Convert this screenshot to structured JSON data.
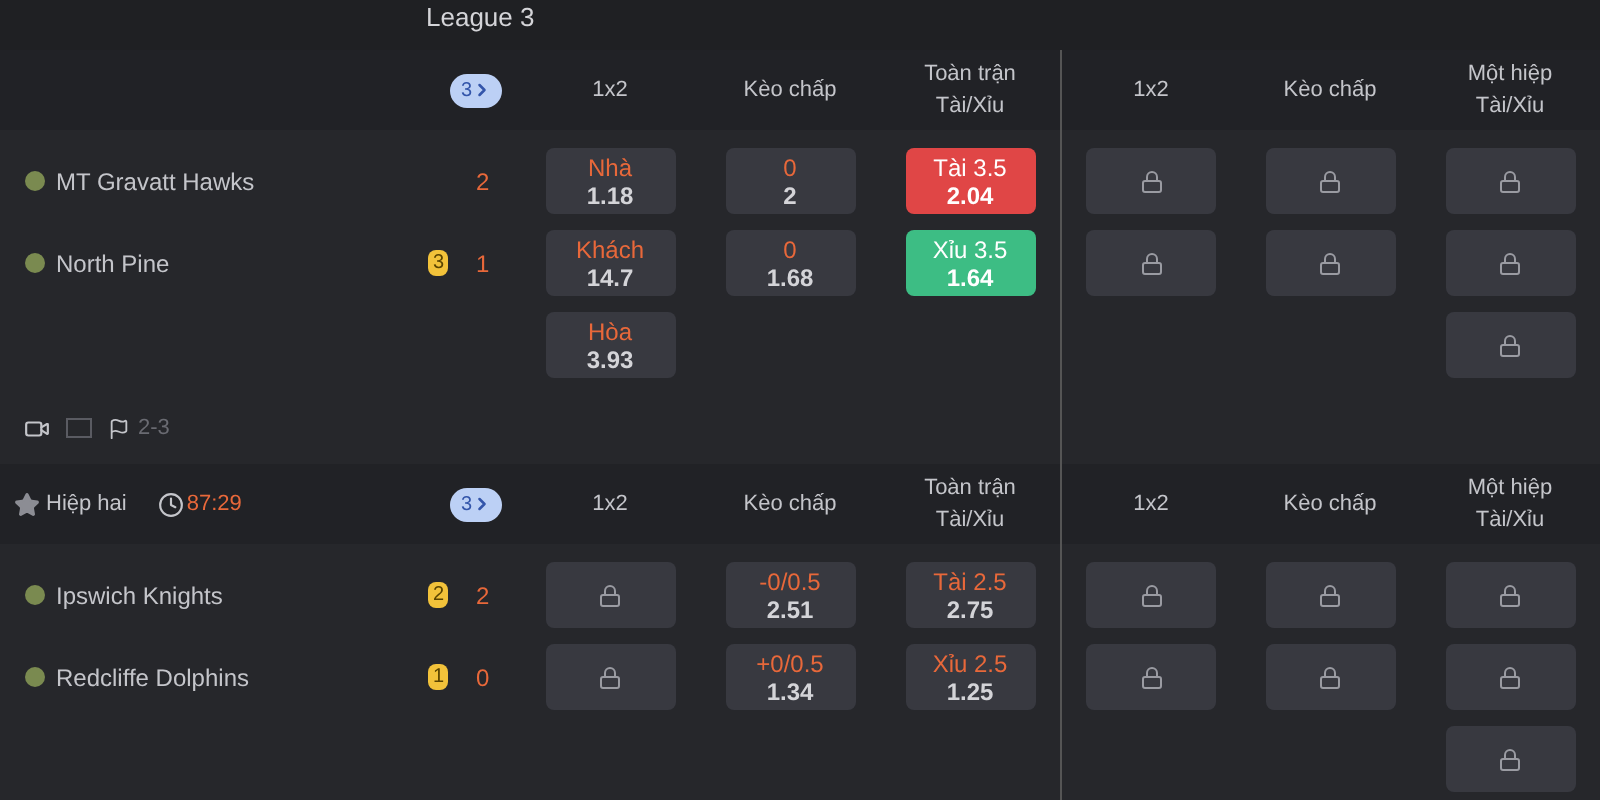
{
  "league": {
    "title": "League 3"
  },
  "matches": [
    {
      "badge": "3",
      "columns": [
        [
          "1x2"
        ],
        [
          "Kèo chấp"
        ],
        [
          "Toàn trận",
          "Tài/Xỉu"
        ],
        [
          "1x2"
        ],
        [
          "Kèo chấp"
        ],
        [
          "Một hiệp",
          "Tài/Xỉu"
        ]
      ],
      "teams": [
        {
          "name": "MT Gravatt Hawks",
          "score": "2"
        },
        {
          "name": "North Pine",
          "cards": "3",
          "score": "1"
        }
      ],
      "markets": [
        {
          "cells": [
            {
              "kind": "odds",
              "label": "Nhà",
              "price": "1.18"
            },
            {
              "kind": "odds",
              "label": "Khách",
              "price": "14.7"
            },
            {
              "kind": "odds",
              "label": "Hòa",
              "price": "3.93"
            }
          ]
        },
        {
          "cells": [
            {
              "kind": "odds",
              "label": "0",
              "price": "2"
            },
            {
              "kind": "odds",
              "label": "0",
              "price": "1.68"
            }
          ]
        },
        {
          "cells": [
            {
              "kind": "odds",
              "label": "Tài 3.5",
              "price": "2.04",
              "color": "#e04646"
            },
            {
              "kind": "odds",
              "label": "Xỉu 3.5",
              "price": "1.64",
              "color": "#3dbd84"
            }
          ]
        },
        {
          "cells": [
            {
              "kind": "locked"
            },
            {
              "kind": "locked"
            }
          ]
        },
        {
          "cells": [
            {
              "kind": "locked"
            },
            {
              "kind": "locked"
            }
          ]
        },
        {
          "cells": [
            {
              "kind": "locked"
            },
            {
              "kind": "locked"
            },
            {
              "kind": "locked"
            }
          ]
        }
      ],
      "footer": {
        "corners": "2-3"
      }
    },
    {
      "status": "Hiệp hai",
      "clock": "87:29",
      "badge": "3",
      "columns": [
        [
          "1x2"
        ],
        [
          "Kèo chấp"
        ],
        [
          "Toàn trận",
          "Tài/Xỉu"
        ],
        [
          "1x2"
        ],
        [
          "Kèo chấp"
        ],
        [
          "Một hiệp",
          "Tài/Xỉu"
        ]
      ],
      "teams": [
        {
          "name": "Ipswich Knights",
          "cards": "2",
          "score": "2"
        },
        {
          "name": "Redcliffe Dolphins",
          "cards": "1",
          "score": "0"
        }
      ],
      "markets": [
        {
          "cells": [
            {
              "kind": "locked"
            },
            {
              "kind": "locked"
            }
          ]
        },
        {
          "cells": [
            {
              "kind": "odds",
              "label": "-0/0.5",
              "price": "2.51"
            },
            {
              "kind": "odds",
              "label": "+0/0.5",
              "price": "1.34"
            }
          ]
        },
        {
          "cells": [
            {
              "kind": "odds",
              "label": "Tài 2.5",
              "price": "2.75"
            },
            {
              "kind": "odds",
              "label": "Xỉu 2.5",
              "price": "1.25"
            }
          ]
        },
        {
          "cells": [
            {
              "kind": "locked"
            },
            {
              "kind": "locked"
            }
          ]
        },
        {
          "cells": [
            {
              "kind": "locked"
            },
            {
              "kind": "locked"
            }
          ]
        },
        {
          "cells": [
            {
              "kind": "locked"
            },
            {
              "kind": "locked"
            },
            {
              "kind": "locked"
            }
          ]
        }
      ]
    }
  ]
}
